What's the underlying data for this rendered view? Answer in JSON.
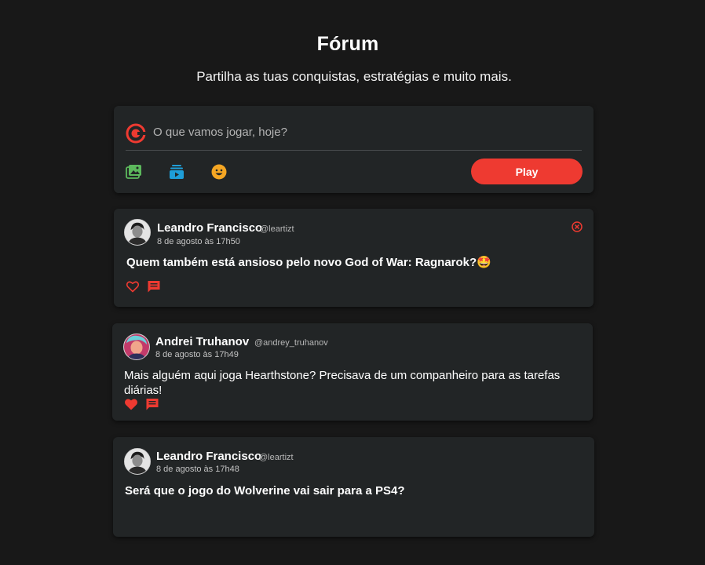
{
  "header": {
    "title": "Fórum",
    "subtitle": "Partilha as tuas conquistas, estratégias e muito mais."
  },
  "composer": {
    "placeholder": "O que vamos jogar, hoje?",
    "tools": [
      "image-icon",
      "video-icon",
      "emoji-icon"
    ],
    "play_label": "Play"
  },
  "colors": {
    "accent": "#ee3a31",
    "background": "#181818",
    "card": "#222526",
    "image_icon": "#5cb85c",
    "video_icon": "#1e9ed8",
    "emoji_icon": "#f5a623"
  },
  "posts": [
    {
      "author": "Leandro Francisco",
      "handle": "@leartizt",
      "date": "8 de agosto às 17h50",
      "text": "Quem também está ansioso pelo novo God of War: Ragnarok?",
      "emoji": "🤩",
      "liked": false,
      "deletable": true
    },
    {
      "author": "Andrei Truhanov",
      "handle": "@andrey_truhanov",
      "date": "8 de agosto às 17h49",
      "text": "Mais alguém aqui joga Hearthstone? Precisava de um companheiro para as tarefas diárias!",
      "liked": true,
      "deletable": false
    },
    {
      "author": "Leandro Francisco",
      "handle": "@leartizt",
      "date": "8 de agosto às 17h48",
      "text": "Será que o jogo do Wolverine vai sair para a PS4?",
      "liked": false,
      "deletable": false
    }
  ]
}
